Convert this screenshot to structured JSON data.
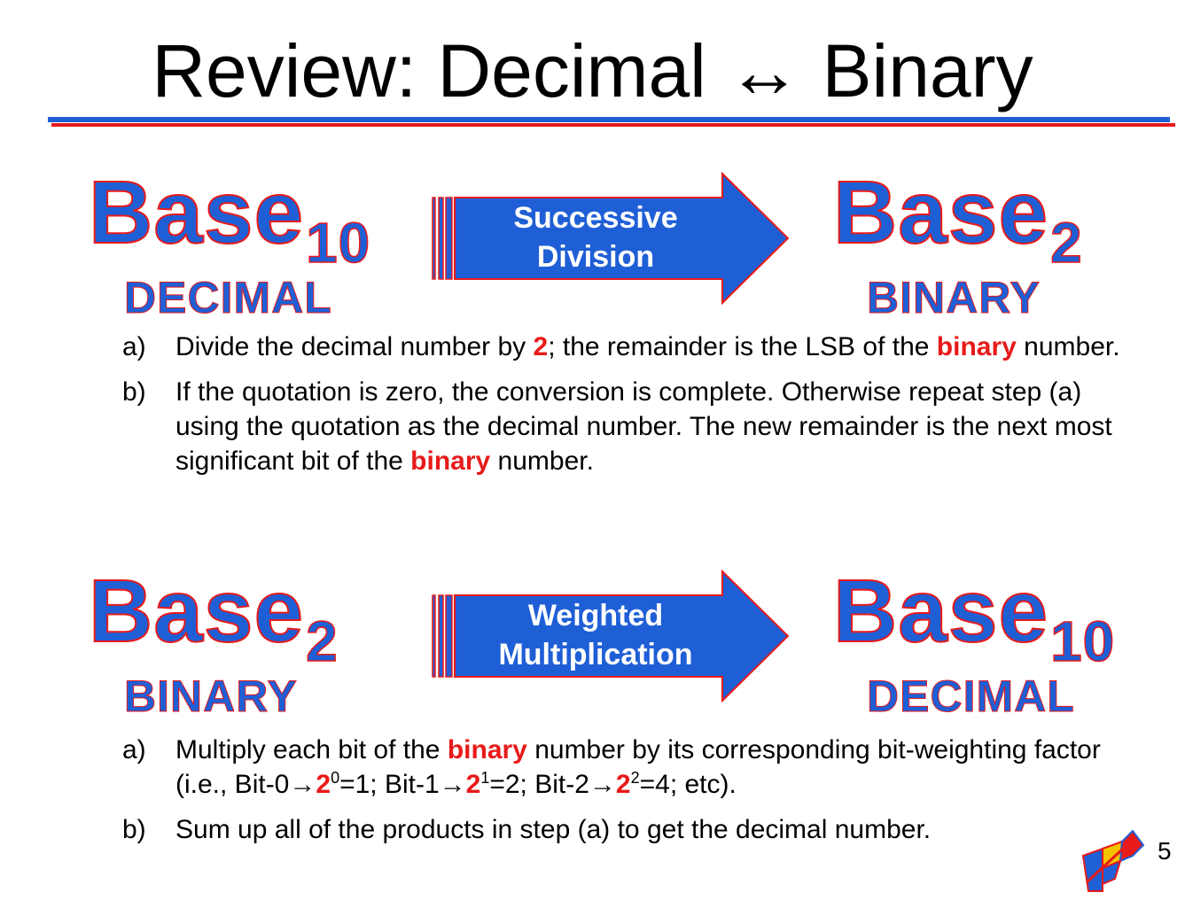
{
  "slide": {
    "title": "Review: Decimal ↔ Binary",
    "page_number": "5"
  },
  "section1": {
    "left_base": "Base",
    "left_sub": "10",
    "left_word": "DECIMAL",
    "arrow_line1": "Successive",
    "arrow_line2": "Division",
    "right_base": "Base",
    "right_sub": "2",
    "right_word": "BINARY",
    "steps": [
      {
        "marker": "a)",
        "t1": "Divide the decimal number by ",
        "h1": "2",
        "t2": "; the remainder is the LSB of the ",
        "h2": "binary",
        "t3": " number."
      },
      {
        "marker": "b)",
        "t1": "If the quotation is zero, the conversion is complete. Otherwise repeat step (a) using the quotation as the decimal number. The new remainder is the next most significant bit of the ",
        "h1": "binary",
        "t2": " number."
      }
    ]
  },
  "section2": {
    "left_base": "Base",
    "left_sub": "2",
    "left_word": "BINARY",
    "arrow_line1": "Weighted",
    "arrow_line2": "Multiplication",
    "right_base": "Base",
    "right_sub": "10",
    "right_word": "DECIMAL",
    "steps": [
      {
        "marker": "a)",
        "t1": "Multiply each bit of the ",
        "h1": "binary",
        "t2": " number by its corresponding bit-weighting factor (i.e., Bit-0→",
        "h2": "2",
        "e0": "0",
        "t3": "=1; Bit-1→",
        "h3": "2",
        "e1": "1",
        "t4": "=2; Bit-2→",
        "h4": "2",
        "e2": "2",
        "t5": "=4; etc)."
      },
      {
        "marker": "b)",
        "t1": "Sum up all of the products in step (a) to get the decimal number."
      }
    ]
  },
  "colors": {
    "accent_blue": "#1f5fd6",
    "accent_red": "#e81a1a"
  },
  "icons": [
    "logo-icon"
  ]
}
